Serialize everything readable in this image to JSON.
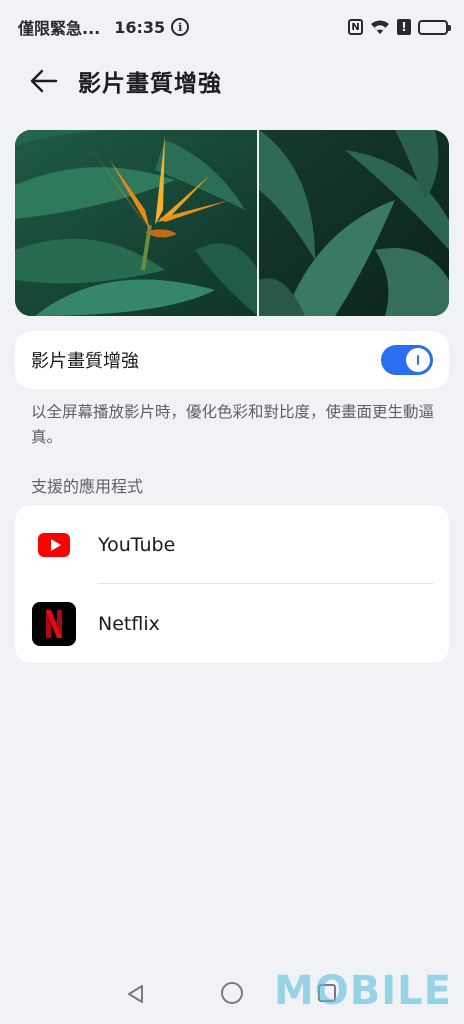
{
  "status_bar": {
    "carrier": "僅限緊急...",
    "time": "16:35",
    "nfc_label": "N",
    "alert_label": "!"
  },
  "header": {
    "title": "影片畫質增強"
  },
  "preview": {
    "image_desc_icon": "bird-of-paradise-leaves-image",
    "split_comparison": true
  },
  "toggle": {
    "label": "影片畫質增強",
    "enabled": true
  },
  "description": "以全屏幕播放影片時，優化色彩和對比度，使畫面更生動逼真。",
  "supported_apps": {
    "section_label": "支援的應用程式",
    "apps": [
      {
        "name": "YouTube",
        "icon": "youtube-icon"
      },
      {
        "name": "Netflix",
        "icon": "netflix-icon"
      }
    ]
  },
  "watermark": "MOBILE",
  "colors": {
    "accent": "#2a6ff0",
    "background": "#f1f2f6",
    "youtube_red": "#fe0000",
    "netflix_red": "#e50914"
  }
}
